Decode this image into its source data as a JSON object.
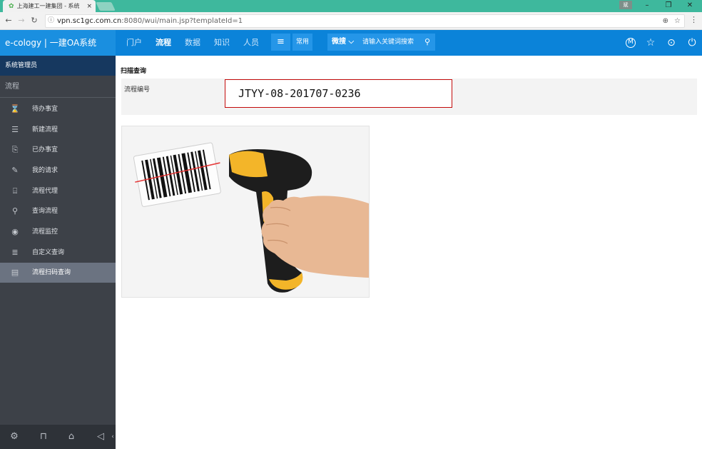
{
  "browser": {
    "tab_title": "上海建工一建集团 - 系统",
    "tab_close": "×",
    "profile_badge": "斌",
    "url_host": "vpn.sc1gc.com.cn",
    "url_rest": ":8080/wui/main.jsp?templateId=1",
    "minimize": "–",
    "restore": "❐",
    "close": "✕"
  },
  "header": {
    "brand": "e-cology | 一建OA系统",
    "nav": [
      "门户",
      "流程",
      "数据",
      "知识",
      "人员"
    ],
    "active_nav_index": 1,
    "menu_btn": "≡",
    "common_btn": "常用",
    "search_scope": "微搜 ⌵",
    "search_placeholder": "请输入关键词搜索",
    "accent": "#0b83d9"
  },
  "sidebar": {
    "admin": "系统管理员",
    "section": "流程",
    "items": [
      {
        "label": "待办事宜",
        "icon": "hourglass-icon",
        "glyph": "⌛"
      },
      {
        "label": "新建流程",
        "icon": "new-doc-icon",
        "glyph": "☰"
      },
      {
        "label": "已办事宜",
        "icon": "done-doc-icon",
        "glyph": "⎘"
      },
      {
        "label": "我的请求",
        "icon": "edit-icon",
        "glyph": "✎"
      },
      {
        "label": "流程代理",
        "icon": "proxy-icon",
        "glyph": "⌸"
      },
      {
        "label": "查询流程",
        "icon": "search-icon",
        "glyph": "⚲"
      },
      {
        "label": "流程监控",
        "icon": "monitor-icon",
        "glyph": "◉"
      },
      {
        "label": "自定义查询",
        "icon": "list-icon",
        "glyph": "≣"
      },
      {
        "label": "流程扫码查询",
        "icon": "scan-icon",
        "glyph": "▤"
      }
    ],
    "active_index": 8
  },
  "main": {
    "page_title": "扫描查询",
    "field_label": "流程编号",
    "field_value": "JTYY-08-201707-0236"
  }
}
